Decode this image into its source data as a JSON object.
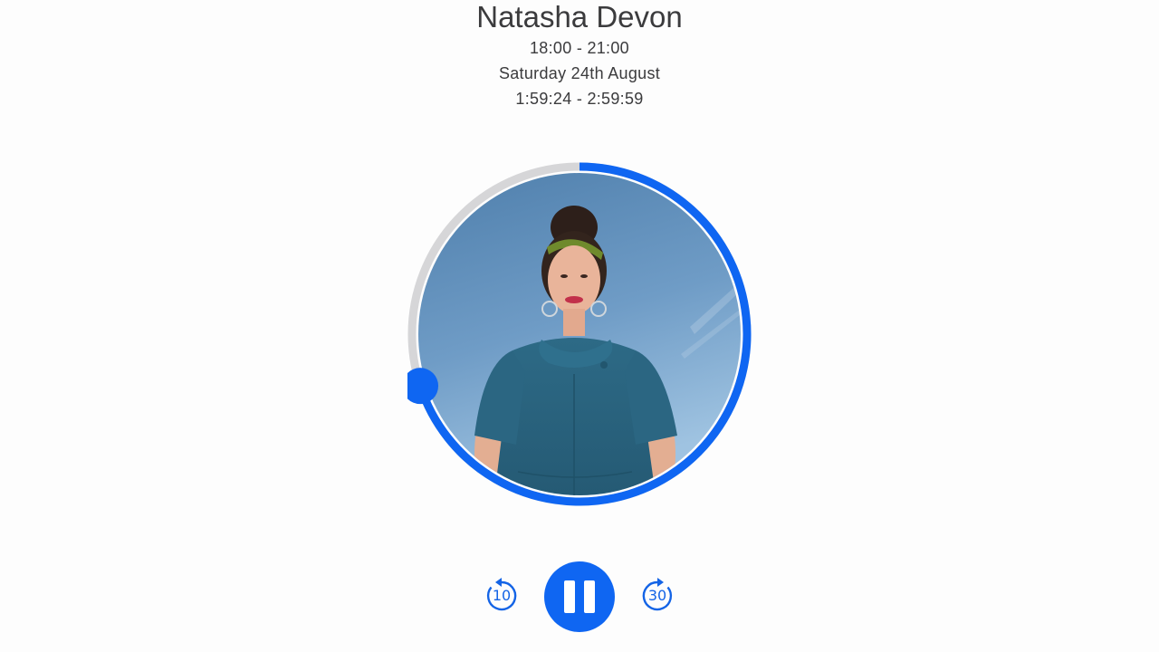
{
  "show": {
    "title": "Natasha Devon",
    "time_slot": "18:00 - 21:00",
    "date": "Saturday 24th August",
    "position_range": "1:59:24 - 2:59:59"
  },
  "progress": {
    "fraction": 0.7,
    "track_color": "#d6d6d8",
    "fill_color": "#0f66f2"
  },
  "controls": {
    "rewind_label": "10",
    "forward_label": "30",
    "play_state": "pause",
    "accent": "#0f66f2"
  },
  "artwork": {
    "icon": "presenter-portrait"
  }
}
